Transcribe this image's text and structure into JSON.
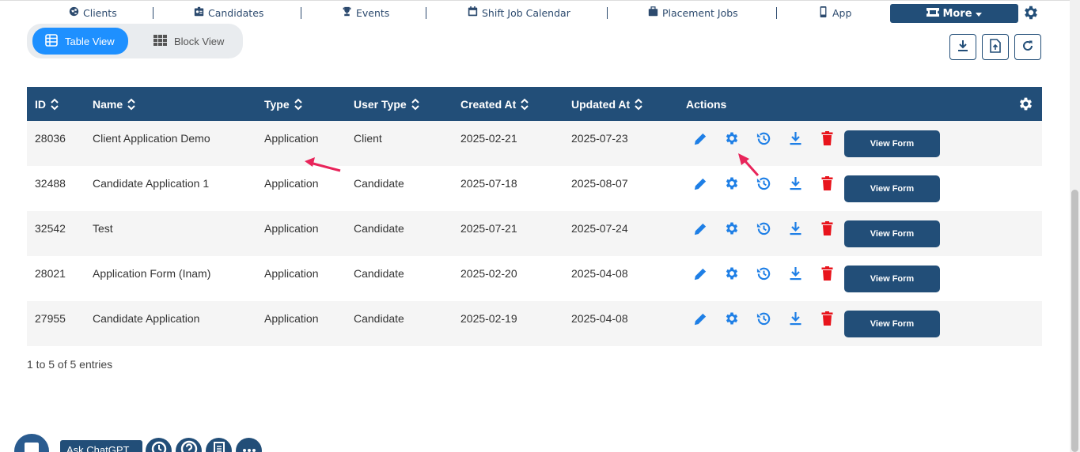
{
  "nav": {
    "items": [
      {
        "label": "Clients",
        "icon": "globe-icon"
      },
      {
        "label": "Candidates",
        "icon": "id-card-icon"
      },
      {
        "label": "Events",
        "icon": "trophy-icon"
      },
      {
        "label": "Shift Job Calendar",
        "icon": "calendar-icon"
      },
      {
        "label": "Placement Jobs",
        "icon": "briefcase-icon"
      },
      {
        "label": "App",
        "icon": "mobile-icon"
      }
    ],
    "more_label": "More"
  },
  "view_toggle": {
    "table_view": "Table View",
    "block_view": "Block View"
  },
  "table": {
    "headers": {
      "id": "ID",
      "name": "Name",
      "type": "Type",
      "user_type": "User Type",
      "created_at": "Created At",
      "updated_at": "Updated At",
      "actions": "Actions"
    },
    "view_form_label": "View Form",
    "rows": [
      {
        "id": "28036",
        "name": "Client Application Demo",
        "type": "Application",
        "user_type": "Client",
        "created_at": "2025-02-21",
        "updated_at": "2025-07-23"
      },
      {
        "id": "32488",
        "name": "Candidate Application 1",
        "type": "Application",
        "user_type": "Candidate",
        "created_at": "2025-07-18",
        "updated_at": "2025-08-07"
      },
      {
        "id": "32542",
        "name": "Test",
        "type": "Application",
        "user_type": "Candidate",
        "created_at": "2025-07-21",
        "updated_at": "2025-07-24"
      },
      {
        "id": "28021",
        "name": "Application Form (Inam)",
        "type": "Application",
        "user_type": "Candidate",
        "created_at": "2025-02-20",
        "updated_at": "2025-04-08"
      },
      {
        "id": "27955",
        "name": "Candidate Application",
        "type": "Application",
        "user_type": "Candidate",
        "created_at": "2025-02-19",
        "updated_at": "2025-04-08"
      }
    ]
  },
  "footer": {
    "entries": "1 to 5 of 5 entries"
  },
  "widgets": {
    "ask_chatgpt": "Ask ChatGPT"
  },
  "colors": {
    "primary": "#224e78",
    "accent": "#1e90ff",
    "action_blue": "#1e7fe6",
    "delete_red": "#e8141c",
    "annotation_arrow": "#e8245a"
  }
}
